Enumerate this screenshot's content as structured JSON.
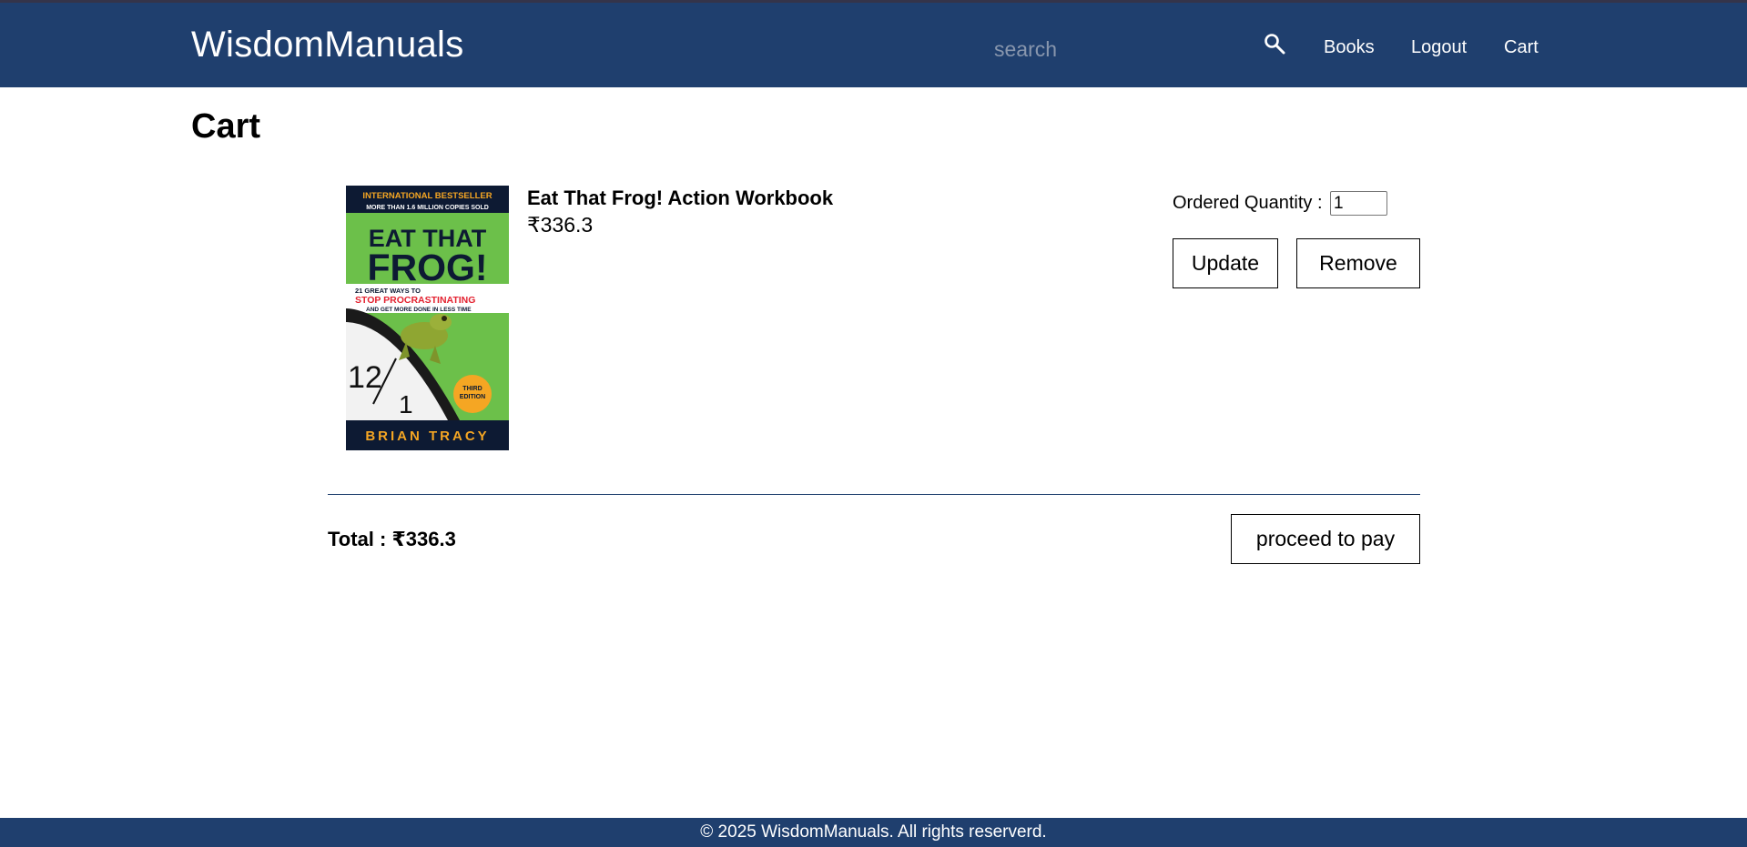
{
  "header": {
    "brand": "WisdomManuals",
    "search": {
      "placeholder": "search",
      "value": "",
      "icon": "search-icon"
    },
    "nav": {
      "books": "Books",
      "logout": "Logout",
      "cart": "Cart"
    },
    "colors": {
      "bar": "#1f3f6e",
      "text": "#ffffff"
    }
  },
  "page": {
    "title": "Cart"
  },
  "cart": {
    "items": [
      {
        "title": "Eat That Frog! Action Workbook",
        "price": "₹336.3",
        "quantity_label": "Ordered Quantity :",
        "quantity": "1",
        "update_label": "Update",
        "remove_label": "Remove",
        "cover": {
          "banner_line1": "INTERNATIONAL BESTSELLER",
          "banner_line2": "MORE THAN 1.6 MILLION COPIES SOLD",
          "title_line1": "EAT THAT",
          "title_line2": "FROG!",
          "subtitle_line1": "21 GREAT WAYS TO",
          "subtitle_line2": "STOP PROCRASTINATING",
          "subtitle_line3": "AND GET MORE DONE IN LESS TIME",
          "badge_line1": "THIRD",
          "badge_line2": "EDITION",
          "author": "BRIAN TRACY"
        }
      }
    ],
    "total": "Total : ₹336.3",
    "proceed_label": "proceed to pay"
  },
  "footer": {
    "text": "© 2025 WisdomManuals. All rights reserverd."
  }
}
